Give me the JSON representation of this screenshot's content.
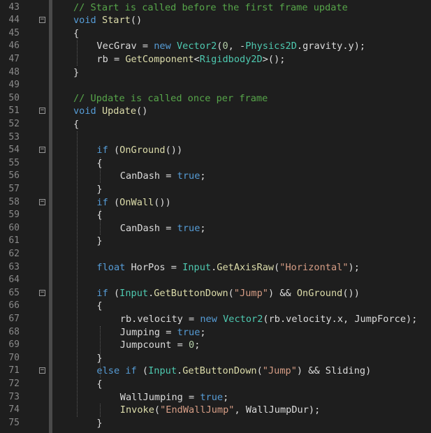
{
  "editor": {
    "colors": {
      "background": "#1e1e1e",
      "keyword": "#569cd6",
      "type": "#4ec9b0",
      "method": "#dcdcaa",
      "string": "#d69d85",
      "number": "#b5cea8",
      "comment": "#57a64a",
      "plain": "#dcdcdc",
      "line_number": "#8a8a8a"
    },
    "lines": [
      {
        "n": "43",
        "indent": 0,
        "fold": false,
        "tokens": [
          {
            "c": "c",
            "t": "// Start is called before the first frame update"
          }
        ]
      },
      {
        "n": "44",
        "indent": 0,
        "fold": true,
        "tokens": [
          {
            "c": "k",
            "t": "void"
          },
          {
            "c": "p",
            "t": " "
          },
          {
            "c": "m",
            "t": "Start"
          },
          {
            "c": "p",
            "t": "()"
          }
        ]
      },
      {
        "n": "45",
        "indent": 0,
        "fold": false,
        "tokens": [
          {
            "c": "p",
            "t": "{"
          }
        ]
      },
      {
        "n": "46",
        "indent": 1,
        "fold": false,
        "tokens": [
          {
            "c": "p",
            "t": "VecGrav = "
          },
          {
            "c": "k",
            "t": "new"
          },
          {
            "c": "p",
            "t": " "
          },
          {
            "c": "t",
            "t": "Vector2"
          },
          {
            "c": "p",
            "t": "("
          },
          {
            "c": "n",
            "t": "0"
          },
          {
            "c": "p",
            "t": ", -"
          },
          {
            "c": "t",
            "t": "Physics2D"
          },
          {
            "c": "p",
            "t": ".gravity.y);"
          }
        ]
      },
      {
        "n": "47",
        "indent": 1,
        "fold": false,
        "tokens": [
          {
            "c": "p",
            "t": "rb = "
          },
          {
            "c": "m",
            "t": "GetComponent"
          },
          {
            "c": "p",
            "t": "<"
          },
          {
            "c": "t",
            "t": "Rigidbody2D"
          },
          {
            "c": "p",
            "t": ">();"
          }
        ]
      },
      {
        "n": "48",
        "indent": 0,
        "fold": false,
        "tokens": [
          {
            "c": "p",
            "t": "}"
          }
        ]
      },
      {
        "n": "49",
        "indent": 0,
        "fold": false,
        "tokens": []
      },
      {
        "n": "50",
        "indent": 0,
        "fold": false,
        "tokens": [
          {
            "c": "c",
            "t": "// Update is called once per frame"
          }
        ]
      },
      {
        "n": "51",
        "indent": 0,
        "fold": true,
        "tokens": [
          {
            "c": "k",
            "t": "void"
          },
          {
            "c": "p",
            "t": " "
          },
          {
            "c": "m",
            "t": "Update"
          },
          {
            "c": "p",
            "t": "()"
          }
        ]
      },
      {
        "n": "52",
        "indent": 0,
        "fold": false,
        "tokens": [
          {
            "c": "p",
            "t": "{"
          }
        ]
      },
      {
        "n": "53",
        "indent": 0,
        "fold": false,
        "tokens": []
      },
      {
        "n": "54",
        "indent": 1,
        "fold": true,
        "tokens": [
          {
            "c": "k",
            "t": "if"
          },
          {
            "c": "p",
            "t": " ("
          },
          {
            "c": "m",
            "t": "OnGround"
          },
          {
            "c": "p",
            "t": "())"
          }
        ]
      },
      {
        "n": "55",
        "indent": 1,
        "fold": false,
        "tokens": [
          {
            "c": "p",
            "t": "{"
          }
        ]
      },
      {
        "n": "56",
        "indent": 2,
        "fold": false,
        "tokens": [
          {
            "c": "p",
            "t": "CanDash = "
          },
          {
            "c": "k",
            "t": "true"
          },
          {
            "c": "p",
            "t": ";"
          }
        ]
      },
      {
        "n": "57",
        "indent": 1,
        "fold": false,
        "tokens": [
          {
            "c": "p",
            "t": "}"
          }
        ]
      },
      {
        "n": "58",
        "indent": 1,
        "fold": true,
        "tokens": [
          {
            "c": "k",
            "t": "if"
          },
          {
            "c": "p",
            "t": " ("
          },
          {
            "c": "m",
            "t": "OnWall"
          },
          {
            "c": "p",
            "t": "())"
          }
        ]
      },
      {
        "n": "59",
        "indent": 1,
        "fold": false,
        "tokens": [
          {
            "c": "p",
            "t": "{"
          }
        ]
      },
      {
        "n": "60",
        "indent": 2,
        "fold": false,
        "tokens": [
          {
            "c": "p",
            "t": "CanDash = "
          },
          {
            "c": "k",
            "t": "true"
          },
          {
            "c": "p",
            "t": ";"
          }
        ]
      },
      {
        "n": "61",
        "indent": 1,
        "fold": false,
        "tokens": [
          {
            "c": "p",
            "t": "}"
          }
        ]
      },
      {
        "n": "62",
        "indent": 0,
        "fold": false,
        "tokens": []
      },
      {
        "n": "63",
        "indent": 1,
        "fold": false,
        "tokens": [
          {
            "c": "k",
            "t": "float"
          },
          {
            "c": "p",
            "t": " HorPos = "
          },
          {
            "c": "t",
            "t": "Input"
          },
          {
            "c": "p",
            "t": "."
          },
          {
            "c": "m",
            "t": "GetAxisRaw"
          },
          {
            "c": "p",
            "t": "("
          },
          {
            "c": "s",
            "t": "\"Horizontal\""
          },
          {
            "c": "p",
            "t": ");"
          }
        ]
      },
      {
        "n": "64",
        "indent": 0,
        "fold": false,
        "tokens": []
      },
      {
        "n": "65",
        "indent": 1,
        "fold": true,
        "tokens": [
          {
            "c": "k",
            "t": "if"
          },
          {
            "c": "p",
            "t": " ("
          },
          {
            "c": "t",
            "t": "Input"
          },
          {
            "c": "p",
            "t": "."
          },
          {
            "c": "m",
            "t": "GetButtonDown"
          },
          {
            "c": "p",
            "t": "("
          },
          {
            "c": "s",
            "t": "\"Jump\""
          },
          {
            "c": "p",
            "t": ") && "
          },
          {
            "c": "m",
            "t": "OnGround"
          },
          {
            "c": "p",
            "t": "())"
          }
        ]
      },
      {
        "n": "66",
        "indent": 1,
        "fold": false,
        "tokens": [
          {
            "c": "p",
            "t": "{"
          }
        ]
      },
      {
        "n": "67",
        "indent": 2,
        "fold": false,
        "tokens": [
          {
            "c": "p",
            "t": "rb.velocity = "
          },
          {
            "c": "k",
            "t": "new"
          },
          {
            "c": "p",
            "t": " "
          },
          {
            "c": "t",
            "t": "Vector2"
          },
          {
            "c": "p",
            "t": "(rb.velocity.x, JumpForce);"
          }
        ]
      },
      {
        "n": "68",
        "indent": 2,
        "fold": false,
        "tokens": [
          {
            "c": "p",
            "t": "Jumping = "
          },
          {
            "c": "k",
            "t": "true"
          },
          {
            "c": "p",
            "t": ";"
          }
        ]
      },
      {
        "n": "69",
        "indent": 2,
        "fold": false,
        "tokens": [
          {
            "c": "p",
            "t": "Jumpcount = "
          },
          {
            "c": "n",
            "t": "0"
          },
          {
            "c": "p",
            "t": ";"
          }
        ]
      },
      {
        "n": "70",
        "indent": 1,
        "fold": false,
        "tokens": [
          {
            "c": "p",
            "t": "}"
          }
        ]
      },
      {
        "n": "71",
        "indent": 1,
        "fold": true,
        "tokens": [
          {
            "c": "k",
            "t": "else"
          },
          {
            "c": "p",
            "t": " "
          },
          {
            "c": "k",
            "t": "if"
          },
          {
            "c": "p",
            "t": " ("
          },
          {
            "c": "t",
            "t": "Input"
          },
          {
            "c": "p",
            "t": "."
          },
          {
            "c": "m",
            "t": "GetButtonDown"
          },
          {
            "c": "p",
            "t": "("
          },
          {
            "c": "s",
            "t": "\"Jump\""
          },
          {
            "c": "p",
            "t": ") && Sliding)"
          }
        ]
      },
      {
        "n": "72",
        "indent": 1,
        "fold": false,
        "tokens": [
          {
            "c": "p",
            "t": "{"
          }
        ]
      },
      {
        "n": "73",
        "indent": 2,
        "fold": false,
        "tokens": [
          {
            "c": "p",
            "t": "WallJumping = "
          },
          {
            "c": "k",
            "t": "true"
          },
          {
            "c": "p",
            "t": ";"
          }
        ]
      },
      {
        "n": "74",
        "indent": 2,
        "fold": false,
        "tokens": [
          {
            "c": "m",
            "t": "Invoke"
          },
          {
            "c": "p",
            "t": "("
          },
          {
            "c": "s",
            "t": "\"EndWallJump\""
          },
          {
            "c": "p",
            "t": ", WallJumpDur);"
          }
        ]
      },
      {
        "n": "75",
        "indent": 1,
        "fold": false,
        "tokens": [
          {
            "c": "p",
            "t": "}"
          }
        ]
      }
    ]
  }
}
